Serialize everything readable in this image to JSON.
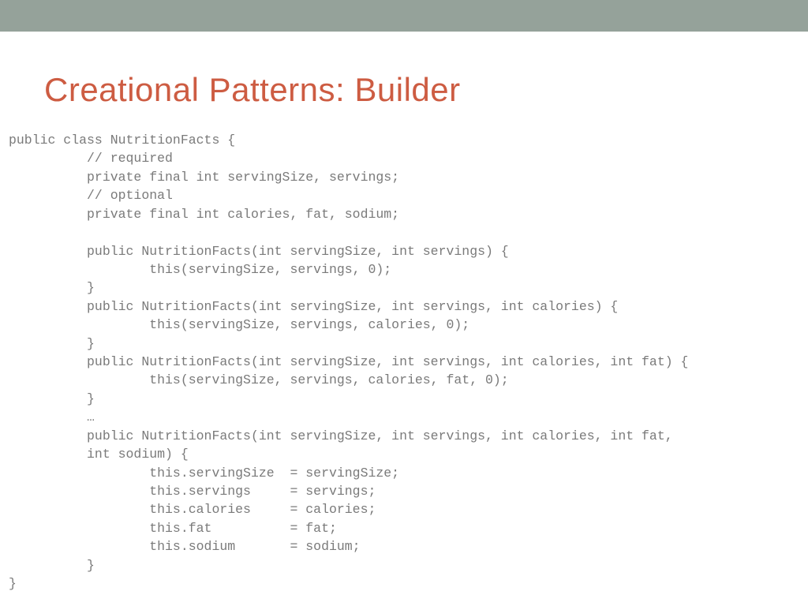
{
  "header": {
    "title": "Creational Patterns: Builder"
  },
  "code": {
    "text": "public class NutritionFacts {\n          // required\n          private final int servingSize, servings;\n          // optional\n          private final int calories, fat, sodium;\n\n          public NutritionFacts(int servingSize, int servings) {\n                  this(servingSize, servings, 0);\n          }\n          public NutritionFacts(int servingSize, int servings, int calories) {\n                  this(servingSize, servings, calories, 0);\n          }\n          public NutritionFacts(int servingSize, int servings, int calories, int fat) {\n                  this(servingSize, servings, calories, fat, 0);\n          }\n          …\n          public NutritionFacts(int servingSize, int servings, int calories, int fat,\n          int sodium) {\n                  this.servingSize  = servingSize;\n                  this.servings     = servings;\n                  this.calories     = calories;\n                  this.fat          = fat;\n                  this.sodium       = sodium;\n          }\n}"
  }
}
